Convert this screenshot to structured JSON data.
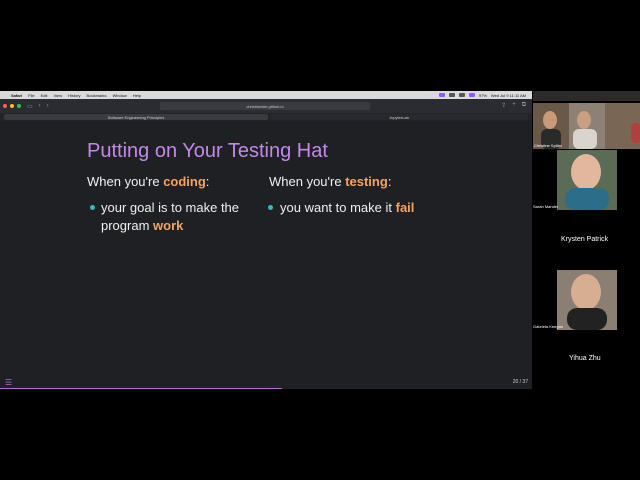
{
  "menubar": {
    "items": [
      "Safari",
      "File",
      "Edit",
      "View",
      "History",
      "Bookmarks",
      "Window",
      "Help"
    ],
    "clock": "Wed Jul 9 11:11 AM",
    "battery": "97%"
  },
  "browser": {
    "url": "christinesier.github.io",
    "tabs": [
      "Software Engineering Principles",
      "JupyterLab"
    ]
  },
  "slide": {
    "title": "Putting on Your Testing Hat",
    "left": {
      "head_prefix": "When you're ",
      "head_accent": "coding",
      "head_suffix": ":",
      "bullet_a": "your goal is to make the",
      "bullet_b": "program ",
      "bullet_accent": "work"
    },
    "right": {
      "head_prefix": "When you're ",
      "head_accent": "testing",
      "head_suffix": ":",
      "bullet_a": "you want to make it ",
      "bullet_accent": "fail"
    },
    "slide_number": "20 / 37"
  },
  "participants": [
    {
      "name": "Christine Spiller",
      "video": true
    },
    {
      "name": "Sarah Mander",
      "video": true
    },
    {
      "name": "Krysten Patrick",
      "video": false
    },
    {
      "name": "Gabriela Keegan",
      "video": true
    },
    {
      "name": "Yihua Zhu",
      "video": false
    }
  ]
}
